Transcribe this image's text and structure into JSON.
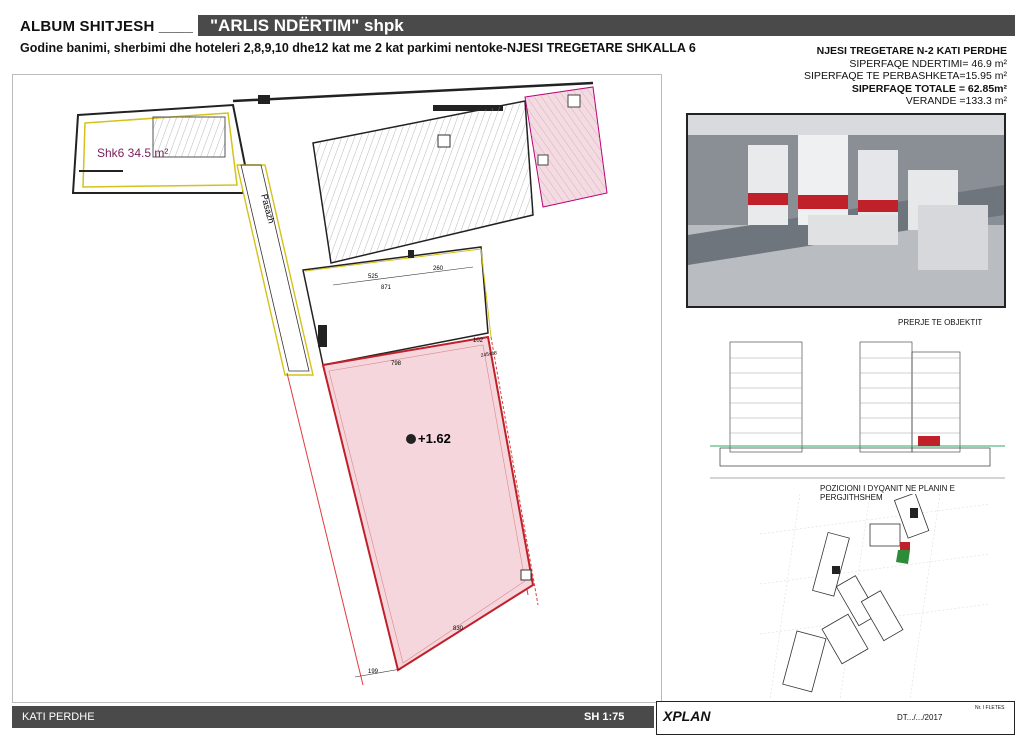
{
  "header": {
    "album": "ALBUM SHITJESH ____",
    "title": "\"ARLIS NDËRTIM\" shpk"
  },
  "subtitle": "Godine banimi, sherbimi dhe hoteleri 2,8,9,10 dhe12 kat me 2 kat parkimi nentoke-NJESI TREGETARE SHKALLA 6",
  "unit_info": {
    "title": "NJESI TREGETARE N-2 KATI PERDHE",
    "built": "SIPERFAQE NDERTIMI= 46.9 m²",
    "shared": "SIPERFAQE TE PERBASHKETA=15.95 m²",
    "total": "SIPERFAQE TOTALE = 62.85m²",
    "veranda": "VERANDE =133.3 m²"
  },
  "plan": {
    "stair_label": "Shk6 34.5 m²",
    "passage": "Pasazh",
    "level": "+1.62",
    "dims": {
      "d525": "525",
      "d260": "260",
      "d871": "871",
      "d798": "798",
      "d102": "102",
      "d830": "830",
      "d199": "199",
      "d245": "245x18"
    }
  },
  "section_title": "PRERJE TE OBJEKTIT",
  "position_title": "POZICIONI I DYQANIT NE PLANIN E PERGJITHSHEM",
  "footer": {
    "floor": "KATI PERDHE",
    "scale": "SH 1:75"
  },
  "titleblock": {
    "brand": "XPLAN",
    "date": "DT.../.../2017",
    "sheet": "Nr. I FLETES"
  },
  "colors": {
    "bar": "#4a4a4a",
    "pink": "#f4d6dc",
    "red_line": "#e23b3b",
    "accent_red": "#c0202a"
  }
}
